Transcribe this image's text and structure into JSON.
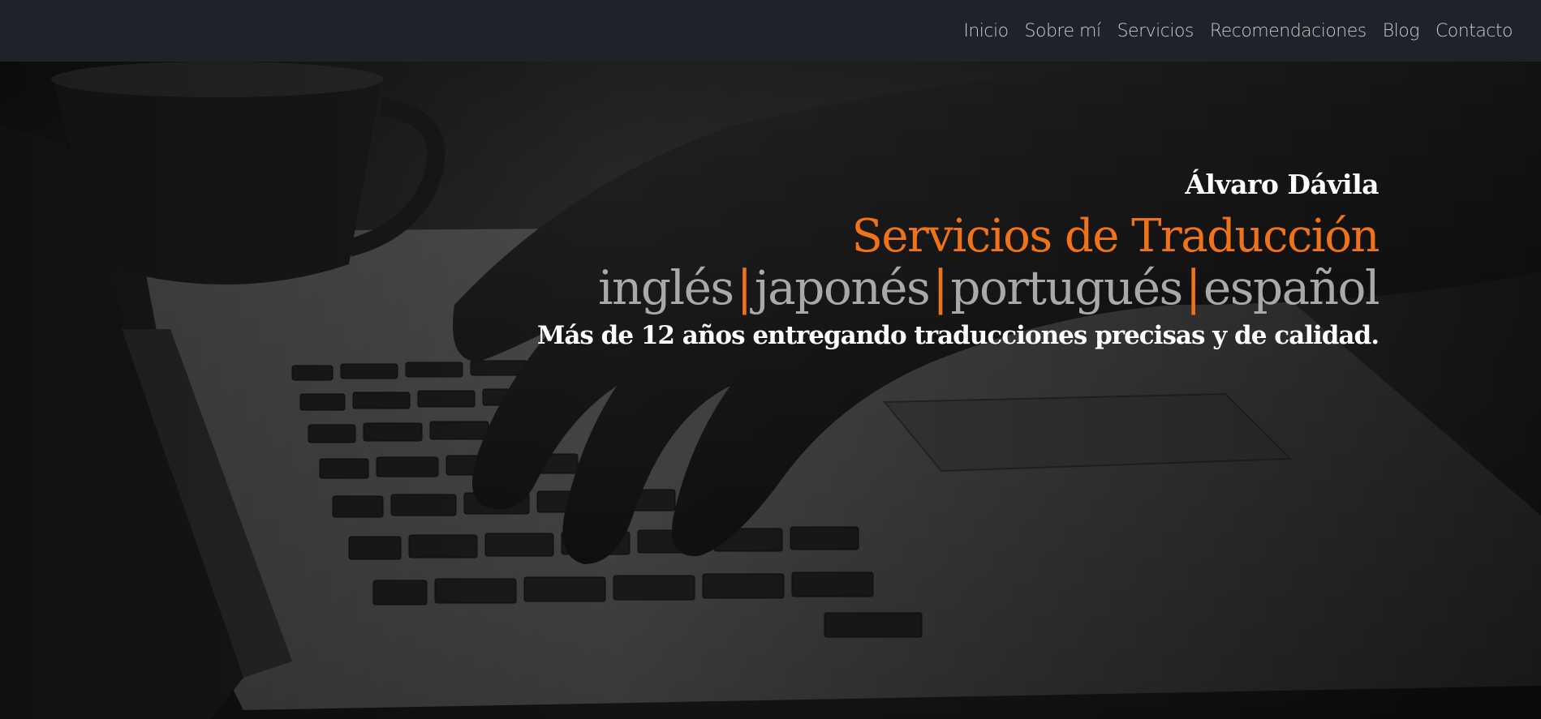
{
  "nav": {
    "items": [
      {
        "label": "Inicio"
      },
      {
        "label": "Sobre mí"
      },
      {
        "label": "Servicios"
      },
      {
        "label": "Recomendaciones"
      },
      {
        "label": "Blog"
      },
      {
        "label": "Contacto"
      }
    ]
  },
  "hero": {
    "name": "Álvaro Dávila",
    "title": "Servicios de Traducción",
    "languages": [
      "inglés",
      "japonés",
      "portugués",
      "español"
    ],
    "separator": "|",
    "tagline": "Más de 12 años entregando traducciones precisas y de calidad.",
    "background_image": "dark photo of hands typing on a laptop keyboard next to a coffee cup"
  },
  "colors": {
    "navbar_bg": "#1f2329",
    "accent": "#f07417",
    "nav_text": "#c9c9c9",
    "language_text": "#a9a9a9",
    "headline_text": "#ffffff"
  }
}
